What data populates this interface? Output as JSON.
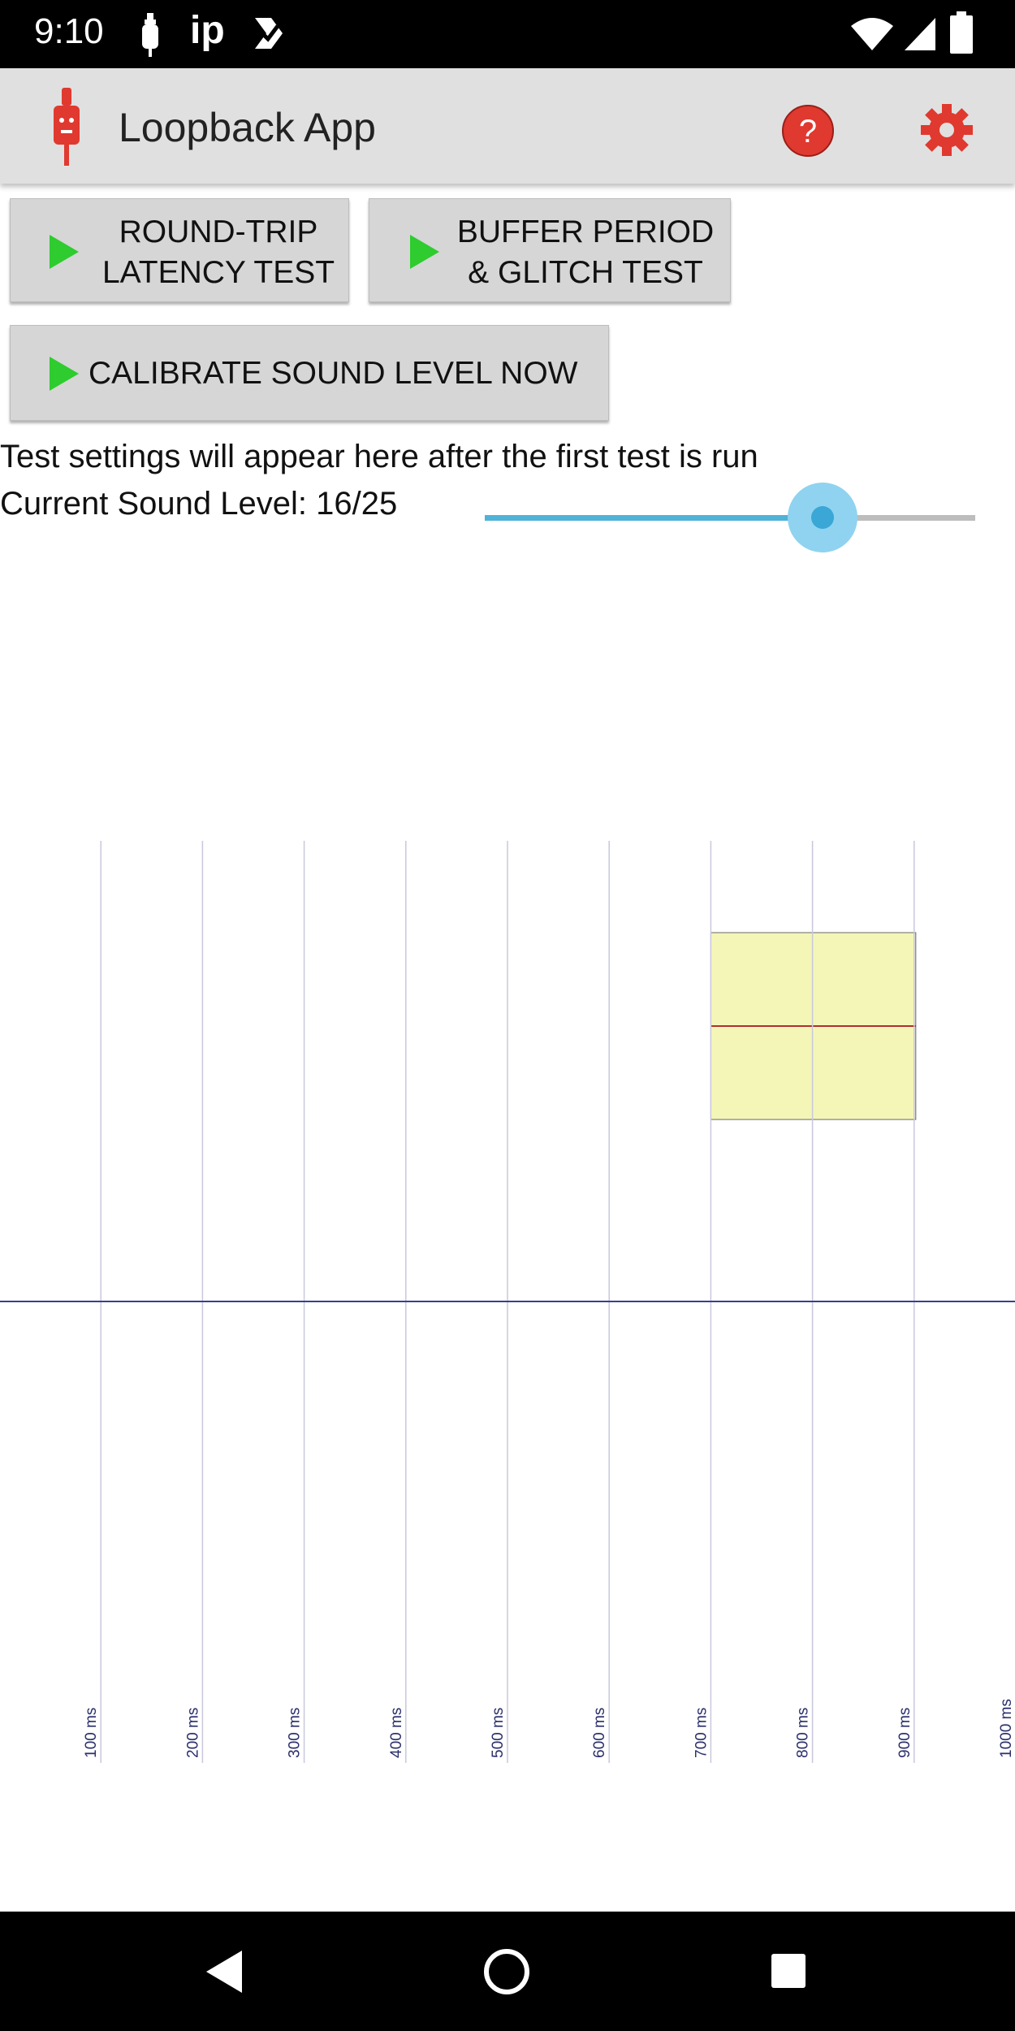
{
  "status_bar": {
    "time": "9:10",
    "carrier_text": "ip",
    "icons": [
      "usb-debug-icon",
      "check-icon",
      "wifi-icon",
      "cell-signal-icon",
      "battery-icon"
    ]
  },
  "app_bar": {
    "title": "Loopback App",
    "icons": [
      "app-logo-icon",
      "help-icon",
      "settings-icon"
    ],
    "accent_color": "#e0392f"
  },
  "buttons": {
    "round_trip_line1": "ROUND-TRIP",
    "round_trip_line2": "LATENCY TEST",
    "buffer_line1": "BUFFER PERIOD",
    "buffer_line2": "& GLITCH TEST",
    "calibrate": "CALIBRATE SOUND LEVEL NOW",
    "play_icon": "play-icon",
    "play_color": "#2ecc2e"
  },
  "info": {
    "settings_text": "Test settings will appear here after the first test is run",
    "sound_level_text": "Current Sound Level: 16/25"
  },
  "slider": {
    "value": 16,
    "max": 25,
    "color": "#4fb2d8"
  },
  "chart_data": {
    "type": "heatmap",
    "x_ticks": [
      "100 ms",
      "200 ms",
      "300 ms",
      "400 ms",
      "500 ms",
      "600 ms",
      "700 ms",
      "800 ms",
      "900 ms",
      "1000 ms"
    ],
    "x_tick_values": [
      100,
      200,
      300,
      400,
      500,
      600,
      700,
      800,
      900,
      1000
    ],
    "xlim": [
      0,
      1000
    ],
    "grid": "vertical",
    "highlight": {
      "x_start": 700,
      "x_end": 900,
      "fill": "#f4f6b8",
      "midline_color": "#b03030"
    },
    "baseline_color": "#3a3f8f",
    "gridline_color": "#c8c8dc"
  },
  "nav_bar": {
    "icons": [
      "back-icon",
      "home-icon",
      "recents-icon"
    ]
  }
}
